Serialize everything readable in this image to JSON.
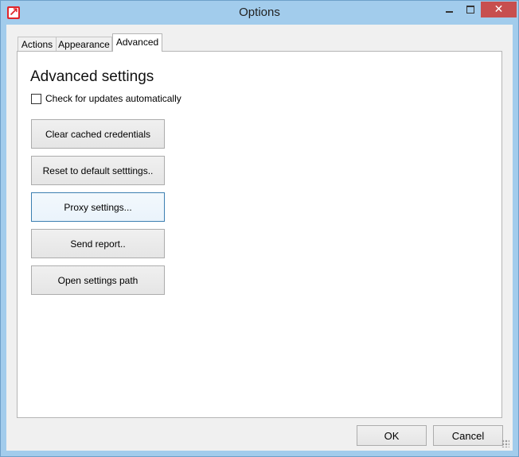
{
  "window": {
    "title": "Options",
    "close_glyph": "✕",
    "accent": "#a2ccec",
    "close_color": "#c74f4f"
  },
  "tabs": [
    {
      "label": "Actions"
    },
    {
      "label": "Appearance"
    },
    {
      "label": "Advanced",
      "selected": true
    }
  ],
  "advanced": {
    "heading": "Advanced settings",
    "check_updates_label": "Check for updates automatically",
    "check_updates_checked": false,
    "buttons": [
      {
        "label": "Clear cached credentials"
      },
      {
        "label": "Reset to default setttings.."
      },
      {
        "label": "Proxy settings...",
        "focused": true
      },
      {
        "label": "Send report.."
      },
      {
        "label": "Open settings path"
      }
    ]
  },
  "footer": {
    "ok_label": "OK",
    "cancel_label": "Cancel"
  }
}
